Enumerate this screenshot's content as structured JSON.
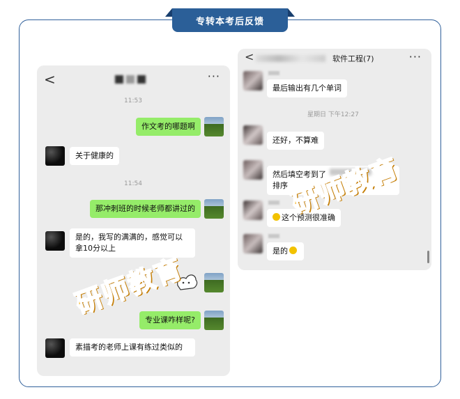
{
  "banner": {
    "title": "专转本考后反馈"
  },
  "watermark": {
    "text": "研师教育"
  },
  "left_chat": {
    "header": {
      "back": "<",
      "more": "···"
    },
    "messages": [
      {
        "time": "11:53"
      },
      {
        "from": "me",
        "text": "作文考的哪题啊"
      },
      {
        "from": "them",
        "text": "关于健康的"
      },
      {
        "time": "11:54"
      },
      {
        "from": "me",
        "text": "那冲刺班的时候老师都讲过的"
      },
      {
        "from": "them",
        "text": "是的，我写的满满的，感觉可以拿10分以上"
      },
      {
        "from": "me",
        "text": "专业课咋样呢?"
      },
      {
        "from": "them",
        "text": "素描考的老师上课有练过类似的"
      }
    ]
  },
  "right_chat": {
    "header": {
      "back": "<",
      "title": "软件工程(7)",
      "more": "···"
    },
    "messages": [
      {
        "from": "them",
        "text": "最后输出有几个单词"
      },
      {
        "time": "星期日 下午12:27"
      },
      {
        "from": "them",
        "text": "还好，不算难"
      },
      {
        "from": "them",
        "text": "然后填空考到了",
        "text2": "排序"
      },
      {
        "from": "them",
        "text": "这个预测很准确"
      },
      {
        "from": "them",
        "text": "是的"
      }
    ]
  },
  "colors": {
    "frame": "#2f5f9a",
    "banner": "#2b5f98",
    "bubble_out": "#95ec69",
    "bubble_in": "#ffffff",
    "chat_bg": "#ececec",
    "watermark": "#f6b21a"
  }
}
